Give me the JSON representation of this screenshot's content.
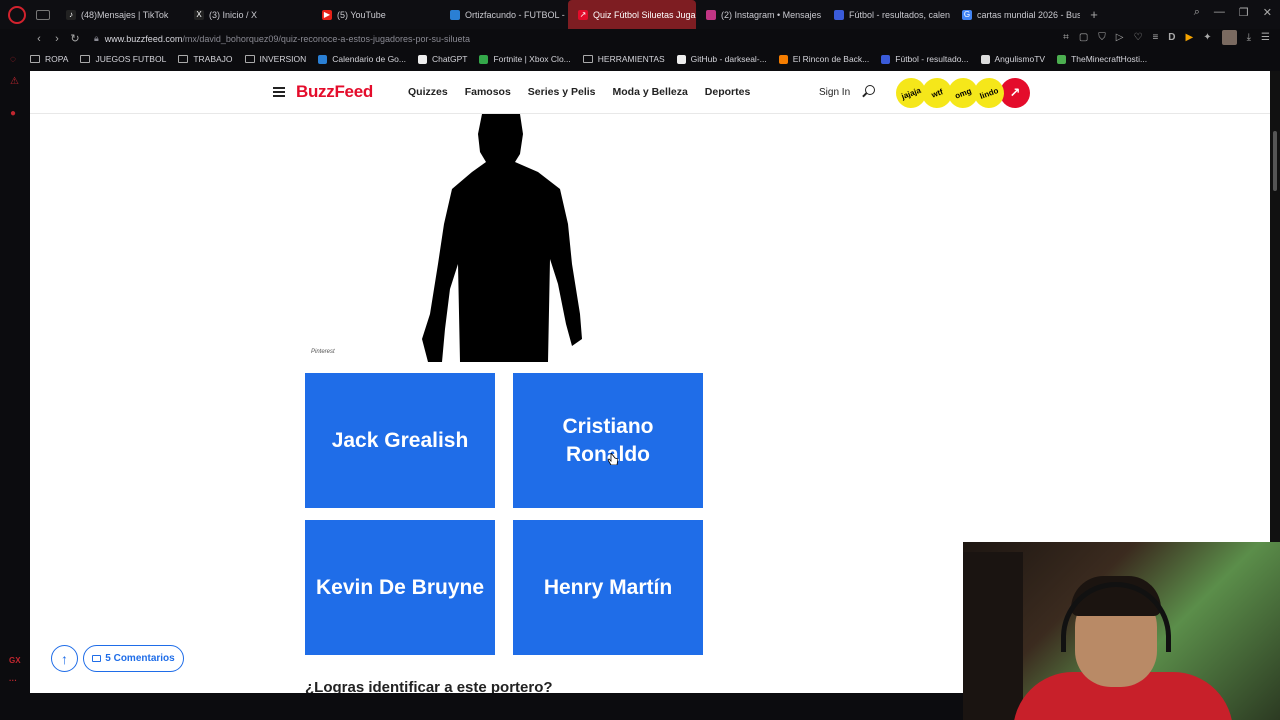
{
  "browser": {
    "tabs": [
      {
        "label": "(48)Mensajes | TikTok",
        "icon": "tiktok-icon",
        "color": "#222222",
        "glyph": "♪"
      },
      {
        "label": "(3) Inicio / X",
        "icon": "x-icon",
        "color": "#222222",
        "glyph": "X"
      },
      {
        "label": "(5) YouTube",
        "icon": "youtube-icon",
        "color": "#e62117",
        "glyph": "▶"
      },
      {
        "label": "Ortizfacundo - FUTBOL -",
        "icon": "page-icon",
        "color": "#2a7fd4",
        "glyph": ""
      },
      {
        "label": "Quiz Fútbol Siluetas Juga",
        "icon": "buzzfeed-icon",
        "color": "#e40c2b",
        "glyph": "↗",
        "active": true
      },
      {
        "label": "(2) Instagram • Mensajes",
        "icon": "instagram-icon",
        "color": "#c13584",
        "glyph": ""
      },
      {
        "label": "Fútbol - resultados, calen",
        "icon": "page-icon",
        "color": "#3a5bd9",
        "glyph": ""
      },
      {
        "label": "cartas mundial 2026 - Bus",
        "icon": "google-icon",
        "color": "#4285f4",
        "glyph": "G"
      }
    ],
    "url_host": "www.buzzfeed.com",
    "url_path": "/mx/david_bohorquez09/quiz-reconoce-a-estos-jugadores-por-su-silueta",
    "bookmarks": [
      {
        "label": "ROPA",
        "icon": "folder-icon"
      },
      {
        "label": "JUEGOS FUTBOL",
        "icon": "folder-icon"
      },
      {
        "label": "TRABAJO",
        "icon": "folder-icon"
      },
      {
        "label": "INVERSION",
        "icon": "folder-icon"
      },
      {
        "label": "Calendario de Go...",
        "icon": "calendar-icon"
      },
      {
        "label": "ChatGPT",
        "icon": "chatgpt-icon"
      },
      {
        "label": "Fortnite | Xbox Clo...",
        "icon": "xbox-icon"
      },
      {
        "label": "HERRAMIENTAS",
        "icon": "folder-icon"
      },
      {
        "label": "GitHub - darkseal-...",
        "icon": "github-icon"
      },
      {
        "label": "El Rincon de Back...",
        "icon": "blogger-icon"
      },
      {
        "label": "Fútbol - resultado...",
        "icon": "page-icon"
      },
      {
        "label": "AngulismoTV",
        "icon": "ball-icon"
      },
      {
        "label": "TheMinecraftHosti...",
        "icon": "minecraft-icon"
      }
    ]
  },
  "header": {
    "logo": "BuzzFeed",
    "nav": [
      "Quizzes",
      "Famosos",
      "Series y Pelis",
      "Moda y Belleza",
      "Deportes"
    ],
    "signin": "Sign In",
    "badges": [
      "jajaja",
      "wtf",
      "omg",
      "lindo"
    ]
  },
  "quiz": {
    "image_credit": "Pinterest",
    "answers": [
      "Jack Grealish",
      "Cristiano Ronaldo",
      "Kevin De Bruyne",
      "Henry Martín"
    ],
    "next_question": "¿Logras identificar a este portero?"
  },
  "footer_actions": {
    "comments_label": "5 Comentarios"
  },
  "sidebar": {
    "bottom_label": "GX"
  },
  "colors": {
    "accent": "#1f6de8",
    "brand": "#e40c2b",
    "badge": "#f5e71a"
  }
}
